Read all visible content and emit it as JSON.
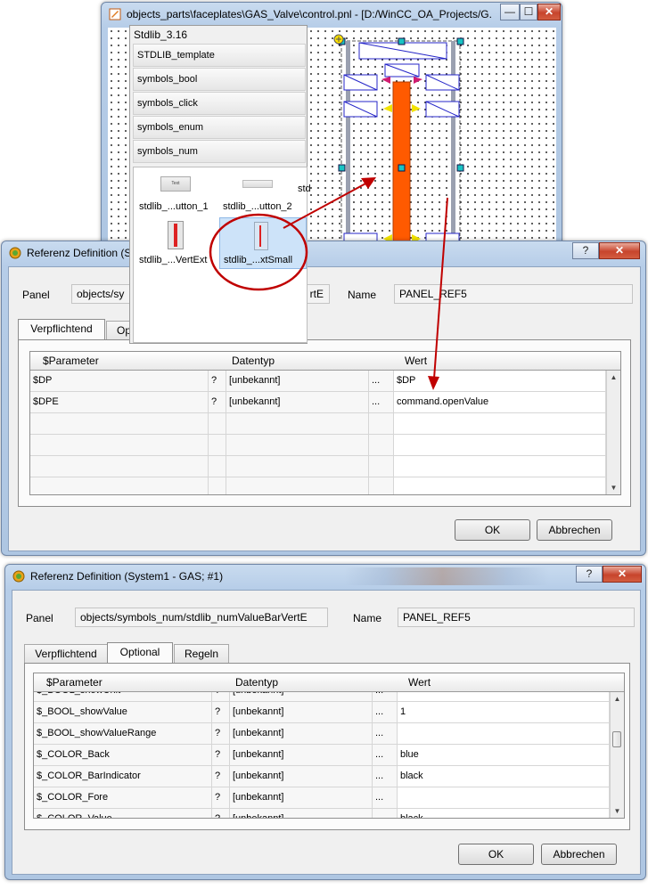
{
  "editor": {
    "title": "objects_parts\\faceplates\\GAS_Valve\\control.pnl - [D:/WinCC_OA_Projects/G...",
    "minimize": "—",
    "maximize": "☐",
    "close": "✕"
  },
  "library": {
    "title": "Stdlib_3.16",
    "categories": [
      "STDLIB_template",
      "symbols_bool",
      "symbols_click",
      "symbols_enum",
      "symbols_num"
    ],
    "thumbs": [
      "stdlib_...utton_1",
      "stdlib_...utton_2",
      "std",
      "stdlib_...VertExt",
      "stdlib_...xtSmall"
    ],
    "btn_label": "Text"
  },
  "dialog1": {
    "title": "Referenz Definition (S",
    "help": "?",
    "close": "✕",
    "panel_label": "Panel",
    "panel_value": "objects/sy",
    "panel_value_tail": "rtE",
    "name_label": "Name",
    "name_value": "PANEL_REF5",
    "tabs": [
      "Verpflichtend",
      "Op"
    ],
    "headers": [
      "$Parameter",
      "Datentyp",
      "Wert"
    ],
    "rows": [
      {
        "param": "$DP",
        "q": "?",
        "type": "[unbekannt]",
        "dots": "...",
        "value": "$DP"
      },
      {
        "param": "$DPE",
        "q": "?",
        "type": "[unbekannt]",
        "dots": "...",
        "value": "command.openValue"
      }
    ],
    "ok": "OK",
    "cancel": "Abbrechen"
  },
  "dialog2": {
    "title": "Referenz Definition (System1 - GAS; #1)",
    "help": "?",
    "close": "✕",
    "panel_label": "Panel",
    "panel_value": "objects/symbols_num/stdlib_numValueBarVertE",
    "name_label": "Name",
    "name_value": "PANEL_REF5",
    "tabs": [
      "Verpflichtend",
      "Optional",
      "Regeln"
    ],
    "headers": [
      "$Parameter",
      "Datentyp",
      "Wert"
    ],
    "rows": [
      {
        "param": "$_BOOL_showUnit",
        "q": "?",
        "type": "[unbekannt]",
        "dots": "...",
        "value": ""
      },
      {
        "param": "$_BOOL_showValue",
        "q": "?",
        "type": "[unbekannt]",
        "dots": "...",
        "value": "1"
      },
      {
        "param": "$_BOOL_showValueRange",
        "q": "?",
        "type": "[unbekannt]",
        "dots": "...",
        "value": ""
      },
      {
        "param": "$_COLOR_Back",
        "q": "?",
        "type": "[unbekannt]",
        "dots": "...",
        "value": "blue"
      },
      {
        "param": "$_COLOR_BarIndicator",
        "q": "?",
        "type": "[unbekannt]",
        "dots": "...",
        "value": "black"
      },
      {
        "param": "$_COLOR_Fore",
        "q": "?",
        "type": "[unbekannt]",
        "dots": "...",
        "value": ""
      },
      {
        "param": "$_COLOR_Value",
        "q": "?",
        "type": "[unbekannt]",
        "dots": "...",
        "value": "black"
      }
    ],
    "ok": "OK",
    "cancel": "Abbrechen"
  },
  "colors": {
    "accent_red": "#c00000",
    "bar_orange": "#ff5a00",
    "selection_blue": "#cde3f9",
    "shape_blue": "#2626c8"
  }
}
